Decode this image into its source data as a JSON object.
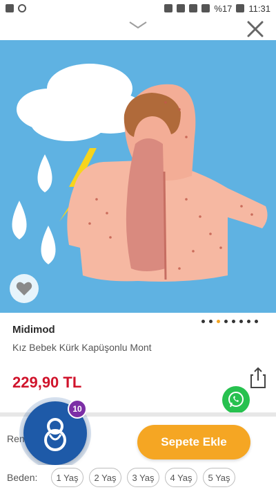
{
  "status_bar": {
    "battery": "%17",
    "time": "11:31"
  },
  "gallery": {
    "dots_count": 8,
    "active_dot": 2
  },
  "product": {
    "brand": "Midimod",
    "name": "Kız Bebek Kürk Kapüşonlu Mont",
    "price": "229,90 TL"
  },
  "action": {
    "color_label": "Ren",
    "cart_button": "Sepete Ekle",
    "badge_count": "10"
  },
  "sizes": {
    "label": "Beden:",
    "options": [
      "1 Yaş",
      "2 Yaş",
      "3 Yaş",
      "4 Yaş",
      "5 Yaş"
    ]
  },
  "colors": {
    "accent": "#f5a623",
    "price": "#d0142c",
    "background_photo": "#5fb2e2",
    "whatsapp": "#27c14f"
  }
}
